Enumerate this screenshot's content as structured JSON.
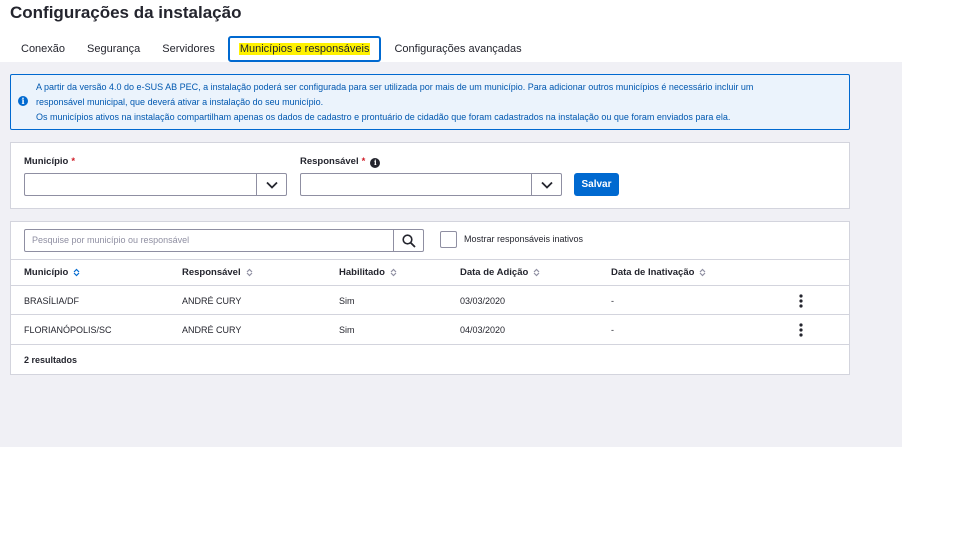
{
  "page": {
    "title": "Configurações da instalação"
  },
  "tabs": [
    {
      "label": "Conexão"
    },
    {
      "label": "Segurança"
    },
    {
      "label": "Servidores"
    },
    {
      "label": "Municípios e responsáveis"
    },
    {
      "label": "Configurações avançadas"
    }
  ],
  "alert": {
    "line1": "A partir da versão 4.0 do e-SUS AB PEC, a instalação poderá ser configurada para ser utilizada por mais de um município. Para adicionar outros municípios é necessário incluir um",
    "line2": "responsável municipal, que deverá ativar a instalação do seu município.",
    "line3": "Os municípios ativos na instalação compartilham apenas os dados de cadastro e prontuário de cidadão que foram cadastrados na instalação ou que foram enviados para ela."
  },
  "form": {
    "municipio_label": "Município",
    "responsavel_label": "Responsável",
    "required_mark": "*",
    "save_label": "Salvar"
  },
  "table": {
    "search_placeholder": "Pesquise por município ou responsável",
    "show_inactive_label": "Mostrar responsáveis inativos",
    "headers": [
      "Município",
      "Responsável",
      "Habilitado",
      "Data de Adição",
      "Data de Inativação"
    ],
    "rows": [
      [
        "BRASÍLIA/DF",
        "ANDRÉ CURY",
        "Sim",
        "03/03/2020",
        "-"
      ],
      [
        "FLORIANÓPOLIS/SC",
        "ANDRÉ CURY",
        "Sim",
        "04/03/2020",
        "-"
      ]
    ],
    "results": "2 resultados"
  },
  "colors": {
    "primary": "#0069d0",
    "highlight": "#fff200",
    "background": "#f0f0f5",
    "alert_bg": "#ebf3fc",
    "required": "#d01e29"
  }
}
